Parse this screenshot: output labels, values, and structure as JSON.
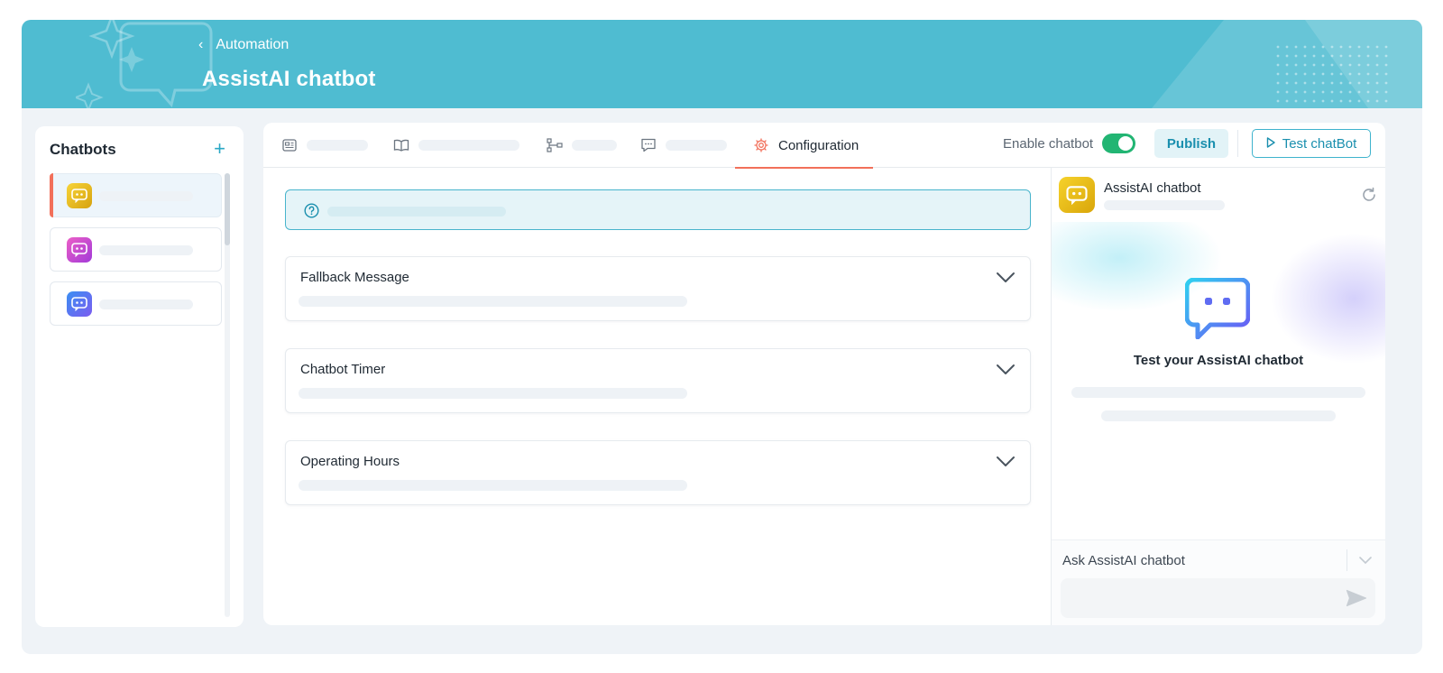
{
  "header": {
    "back_label": "Automation",
    "title": "AssistAI chatbot"
  },
  "sidebar": {
    "title": "Chatbots",
    "add_icon": "plus-icon",
    "items": [
      {
        "avatar_gradient": [
          "#f7d43a",
          "#d6a20e"
        ],
        "active": true
      },
      {
        "avatar_gradient": [
          "#ec5fc7",
          "#a23ad8"
        ],
        "active": false
      },
      {
        "avatar_gradient": [
          "#3b8ff3",
          "#7b5cf0"
        ],
        "active": false
      }
    ]
  },
  "tabs": [
    {
      "icon": "id-card-icon",
      "label": ""
    },
    {
      "icon": "book-icon",
      "label": ""
    },
    {
      "icon": "flow-icon",
      "label": ""
    },
    {
      "icon": "chat-icon",
      "label": ""
    },
    {
      "icon": "gear-icon",
      "label": "Configuration",
      "active": true
    }
  ],
  "toolbar": {
    "enable_label": "Enable chatbot",
    "enabled": true,
    "publish_label": "Publish",
    "test_label": "Test chatBot"
  },
  "config": {
    "sections": [
      {
        "title": "Fallback Message"
      },
      {
        "title": "Chatbot Timer"
      },
      {
        "title": "Operating Hours"
      }
    ]
  },
  "chat_preview": {
    "bot_name": "AssistAI chatbot",
    "heading": "Test your AssistAI chatbot",
    "ask_label": "Ask AssistAI chatbot",
    "input_placeholder": ""
  },
  "colors": {
    "header_bg": "#4fbcd1",
    "accent": "#1a8fae",
    "active_tab_underline": "#f2705a",
    "toggle_on": "#22b573"
  }
}
